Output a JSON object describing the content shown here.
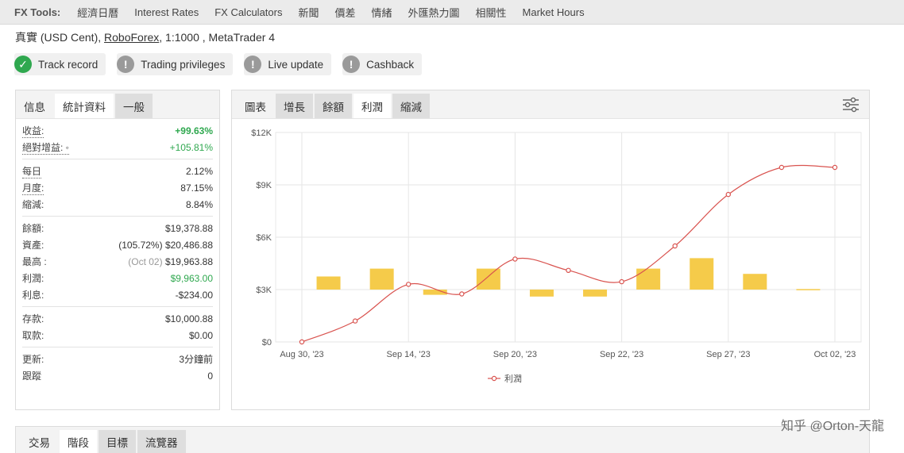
{
  "topbar": {
    "brand": "FX Tools:",
    "items": [
      "經濟日曆",
      "Interest Rates",
      "FX Calculators",
      "新聞",
      "價差",
      "情緒",
      "外匯熱力圖",
      "相關性",
      "Market Hours"
    ]
  },
  "account": {
    "prefix": "真實 (USD Cent),",
    "broker": "RoboForex",
    "suffix": ", 1:1000 , MetaTrader 4"
  },
  "badges": [
    {
      "label": "Track record",
      "icon": "check-icon",
      "status": "ok"
    },
    {
      "label": "Trading privileges",
      "icon": "exclamation-icon",
      "status": "warn"
    },
    {
      "label": "Live update",
      "icon": "exclamation-icon",
      "status": "warn"
    },
    {
      "label": "Cashback",
      "icon": "exclamation-icon",
      "status": "warn"
    }
  ],
  "stats_tabs": [
    "信息",
    "統計資料",
    "一般"
  ],
  "stats": {
    "gain_label": "收益:",
    "gain_value": "+99.63%",
    "abs_label": "絕對增益: ◦",
    "abs_value": "+105.81%",
    "daily_label": "每日",
    "daily_value": "2.12%",
    "monthly_label": "月度:",
    "monthly_value": "87.15%",
    "drawdown_label": "縮減:",
    "drawdown_value": "8.84%",
    "balance_label": "餘額:",
    "balance_value": "$19,378.88",
    "equity_label": "資產:",
    "equity_pct": "(105.72%)",
    "equity_value": "$20,486.88",
    "highest_label": "最高 :",
    "highest_date": "(Oct 02)",
    "highest_value": "$19,963.88",
    "profit_label": "利潤:",
    "profit_value": "$9,963.00",
    "interest_label": "利息:",
    "interest_value": "-$234.00",
    "deposits_label": "存款:",
    "deposits_value": "$10,000.88",
    "withdrawals_label": "取款:",
    "withdrawals_value": "$0.00",
    "updated_label": "更新:",
    "updated_value": "3分鐘前",
    "tracking_label": "跟蹤",
    "tracking_value": "0"
  },
  "chart_tabs": [
    "圖表",
    "增長",
    "餘額",
    "利潤",
    "縮減"
  ],
  "bottom_tabs": [
    "交易",
    "階段",
    "目標",
    "流覽器"
  ],
  "colors": {
    "accent_green": "#2fa84f",
    "bar": "#f5cb4a",
    "line": "#d9534f"
  },
  "watermark": "知乎 @Orton-天龍",
  "chart_data": {
    "type": "bar+line",
    "categories": [
      "Aug 30, '23",
      "",
      "Sep 14, '23",
      "",
      "Sep 20, '23",
      "",
      "Sep 22, '23",
      "",
      "Sep 27, '23",
      "",
      "Oct 02, '23"
    ],
    "x_tick_labels": [
      "Aug 30, '23",
      "Sep 14, '23",
      "Sep 20, '23",
      "Sep 22, '23",
      "Sep 27, '23",
      "Oct 02, '23"
    ],
    "y_tick_labels": [
      "$0",
      "$3K",
      "$6K",
      "$9K",
      "$12K"
    ],
    "ylim": [
      0,
      12000
    ],
    "bars": {
      "base": 3000,
      "deltas": [
        750,
        1200,
        -300,
        1200,
        -400,
        -400,
        1200,
        1800,
        900,
        30
      ]
    },
    "series": [
      {
        "name": "利潤",
        "values": [
          0,
          1200,
          3300,
          2750,
          4750,
          4100,
          3450,
          5500,
          8450,
          10000,
          10000
        ]
      }
    ],
    "legend": "bottom-center",
    "grid": true
  }
}
